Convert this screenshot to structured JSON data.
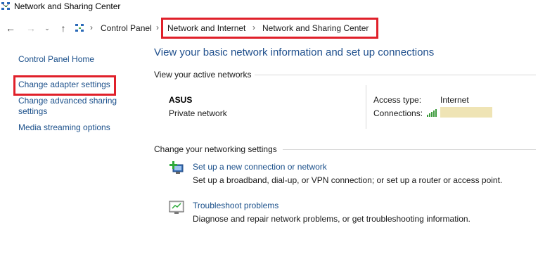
{
  "window": {
    "title": "Network and Sharing Center"
  },
  "breadcrumb": {
    "items": [
      "Control Panel",
      "Network and Internet",
      "Network and Sharing Center"
    ]
  },
  "sidebar": {
    "items": [
      {
        "label": "Control Panel Home"
      },
      {
        "label": "Change adapter settings"
      },
      {
        "label_line1": "Change advanced sharing",
        "label_line2": "settings"
      },
      {
        "label": "Media streaming options"
      }
    ]
  },
  "main": {
    "heading": "View your basic network information and set up connections",
    "active_networks": {
      "title": "View your active networks",
      "network_name": "ASUS",
      "network_category": "Private network",
      "access_type_label": "Access type:",
      "access_type_value": "Internet",
      "connections_label": "Connections:"
    },
    "settings": {
      "title": "Change your networking settings",
      "tasks": [
        {
          "link": "Set up a new connection or network",
          "description": "Set up a broadband, dial-up, or VPN connection; or set up a router or access point.",
          "icon": "new-connection-icon"
        },
        {
          "link": "Troubleshoot problems",
          "description": "Diagnose and repair network problems, or get troubleshooting information.",
          "icon": "troubleshoot-icon"
        }
      ]
    }
  },
  "colors": {
    "link": "#1a4f8a",
    "heading": "#1e4e8c",
    "highlight": "#e0202a",
    "redacted": "#efe4b5"
  }
}
